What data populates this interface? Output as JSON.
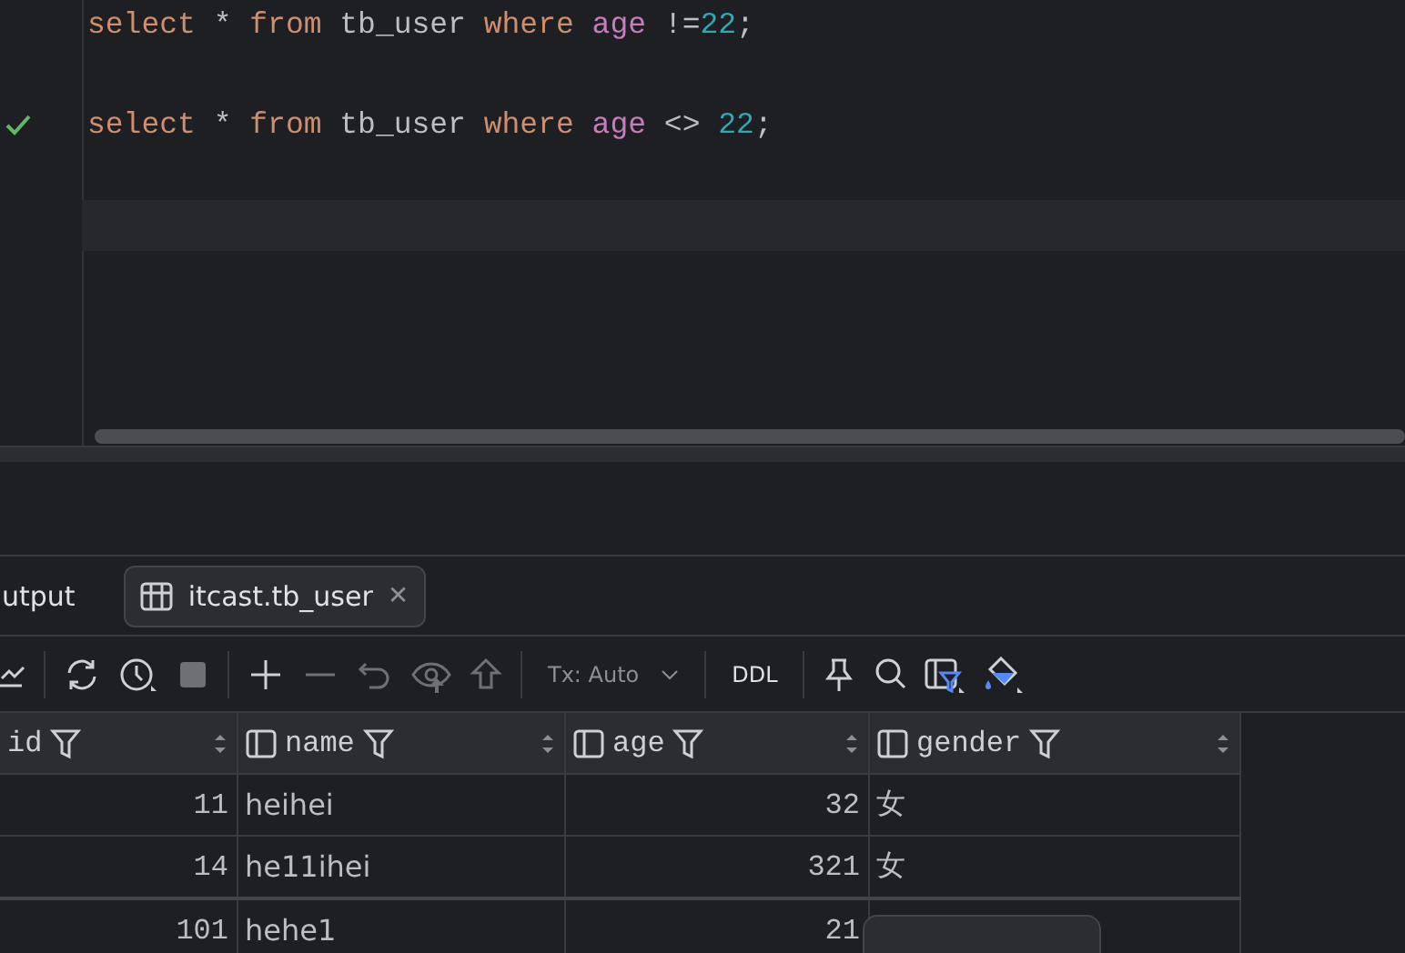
{
  "editor": {
    "lines": [
      {
        "executed": false,
        "current": false,
        "tokens": [
          {
            "kind": "keyword",
            "text": "select"
          },
          {
            "kind": "plain",
            "text": " * "
          },
          {
            "kind": "keyword",
            "text": "from"
          },
          {
            "kind": "plain",
            "text": " tb_user "
          },
          {
            "kind": "keyword",
            "text": "where "
          },
          {
            "kind": "column",
            "text": "age"
          },
          {
            "kind": "plain",
            "text": " !="
          },
          {
            "kind": "number",
            "text": "22"
          },
          {
            "kind": "plain",
            "text": ";"
          }
        ]
      },
      {
        "executed": false,
        "current": false
      },
      {
        "executed": true,
        "current": false,
        "tokens": [
          {
            "kind": "keyword",
            "text": "select"
          },
          {
            "kind": "plain",
            "text": " * "
          },
          {
            "kind": "keyword",
            "text": "from"
          },
          {
            "kind": "plain",
            "text": " tb_user "
          },
          {
            "kind": "keyword",
            "text": "where "
          },
          {
            "kind": "column",
            "text": "age"
          },
          {
            "kind": "plain",
            "text": " <> "
          },
          {
            "kind": "number",
            "text": "22"
          },
          {
            "kind": "plain",
            "text": ";"
          }
        ]
      },
      {
        "executed": false,
        "current": false
      },
      {
        "executed": false,
        "current": true
      }
    ]
  },
  "tabs": [
    {
      "label": "utput",
      "kind": "plain",
      "selected": false
    },
    {
      "label": "itcast.tb_user",
      "kind": "table",
      "selected": true,
      "close": "✕"
    }
  ],
  "toolbar": {
    "tx_mode": "Tx: Auto",
    "ddl": "DDL"
  },
  "table": {
    "columns": [
      {
        "name": "id",
        "kind": "number",
        "icon": false
      },
      {
        "name": "name",
        "kind": "text",
        "icon": true
      },
      {
        "name": "age",
        "kind": "number",
        "icon": true
      },
      {
        "name": "gender",
        "kind": "text",
        "icon": true
      }
    ],
    "rows": [
      [
        "11",
        "heihei",
        "32",
        "女"
      ],
      [
        "14",
        "he11ihei",
        "321",
        "女"
      ],
      [
        "101",
        "hehe1",
        "21",
        ""
      ]
    ]
  }
}
